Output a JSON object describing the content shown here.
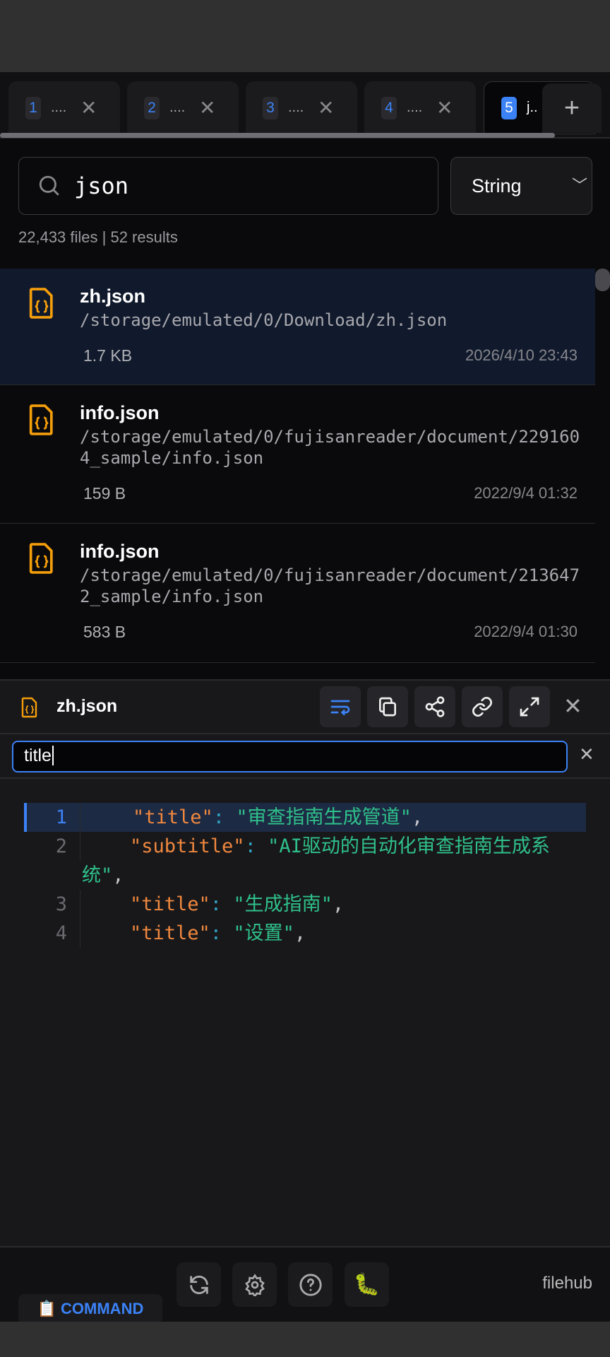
{
  "tabs": [
    {
      "num": "1",
      "label": "...."
    },
    {
      "num": "2",
      "label": "...."
    },
    {
      "num": "3",
      "label": "...."
    },
    {
      "num": "4",
      "label": "...."
    },
    {
      "num": "5",
      "label": "j.."
    }
  ],
  "search": {
    "query": "json",
    "mode": "String",
    "status": "22,433 files | 52 results"
  },
  "results": [
    {
      "name": "zh.json",
      "path": "/storage/emulated/0/Download/zh.json",
      "size": "1.7 KB",
      "date": "2026/4/10 23:43"
    },
    {
      "name": "info.json",
      "path": "/storage/emulated/0/fujisanreader/document/2291604_sample/info.json",
      "size": "159 B",
      "date": "2022/9/4 01:32"
    },
    {
      "name": "info.json",
      "path": "/storage/emulated/0/fujisanreader/document/2136472_sample/info.json",
      "size": "583 B",
      "date": "2022/9/4 01:30"
    }
  ],
  "preview": {
    "title": "zh.json",
    "filter": "title",
    "lines": [
      {
        "n": "1",
        "key": "\"title\"",
        "val": "\"审查指南生成管道\""
      },
      {
        "n": "2",
        "key": "\"subtitle\"",
        "val": "\"AI驱动的自动化审查指南生成系",
        "cont": "统\""
      },
      {
        "n": "3",
        "key": "\"title\"",
        "val": "\"生成指南\""
      },
      {
        "n": "4",
        "key": "\"title\"",
        "val": "\"设置\""
      }
    ]
  },
  "footer": {
    "command": "COMMAND",
    "brand": "filehub"
  },
  "colors": {
    "accent": "#3b82f6",
    "file_icon": "#f59e0b",
    "key": "#f0883e",
    "string": "#2fc08a"
  }
}
